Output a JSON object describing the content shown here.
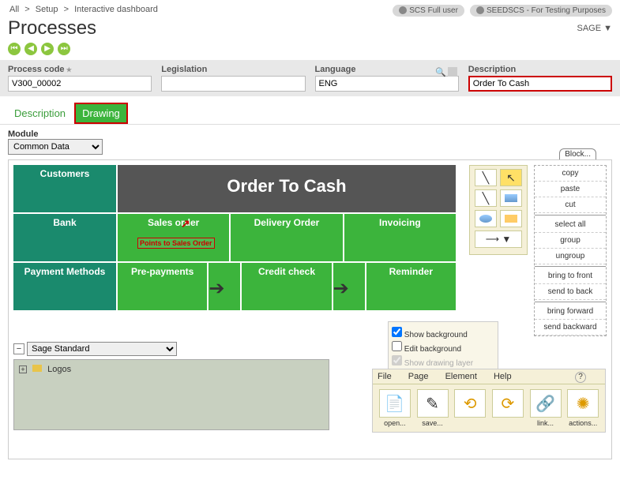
{
  "breadcrumb": {
    "all": "All",
    "setup": "Setup",
    "dash": "Interactive dashboard"
  },
  "header_buttons": {
    "scs": "SCS Full user",
    "seed": "SEEDSCS - For Testing Purposes"
  },
  "title": "Processes",
  "sage": "SAGE ▼",
  "filters": {
    "code_label": "Process code",
    "code_value": "V300_00002",
    "legis_label": "Legislation",
    "lang_label": "Language",
    "lang_value": "ENG",
    "desc_label": "Description",
    "desc_value": "Order To Cash"
  },
  "tabs": {
    "description": "Description",
    "drawing": "Drawing"
  },
  "module": {
    "label": "Module",
    "value": "Common Data"
  },
  "block_label": "Block...",
  "grid": {
    "title": "Order To Cash",
    "customers": "Customers",
    "bank": "Bank",
    "payment": "Payment Methods",
    "sales": "Sales order",
    "delivery": "Delivery Order",
    "invoicing": "Invoicing",
    "prepay": "Pre-payments",
    "credit": "Credit check",
    "reminder": "Reminder",
    "annotation": "Points to Sales Order"
  },
  "ctx": {
    "copy": "copy",
    "paste": "paste",
    "cut": "cut",
    "selectall": "select all",
    "group": "group",
    "ungroup": "ungroup",
    "front": "bring to front",
    "back": "send to back",
    "forward": "bring forward",
    "backward": "send backward"
  },
  "bg": {
    "show": "Show background",
    "edit": "Edit background",
    "layer": "Show drawing layer"
  },
  "sage_panel": {
    "value": "Sage Standard",
    "tree": "Logos"
  },
  "toolbar": {
    "file": "File",
    "page": "Page",
    "element": "Element",
    "help": "Help",
    "open": "open...",
    "save": "save...",
    "link": "link...",
    "actions": "actions..."
  }
}
